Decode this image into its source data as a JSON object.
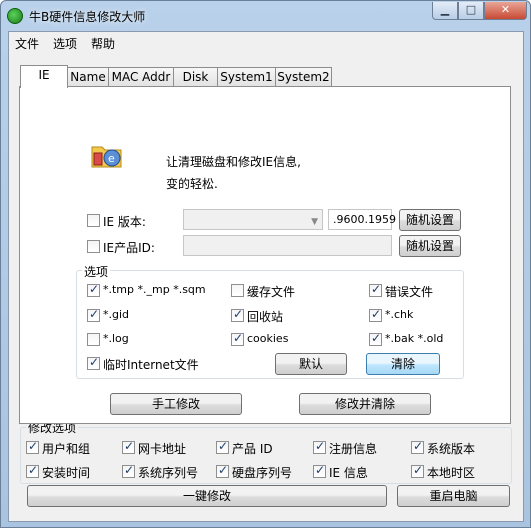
{
  "window": {
    "title": "牛B硬件信息修改大师"
  },
  "menu": [
    "文件",
    "选项",
    "帮助"
  ],
  "tabs": [
    "IE",
    "Name",
    "MAC Addr",
    "Disk",
    "System1",
    "System2"
  ],
  "ie_panel": {
    "desc_line1": "让清理磁盘和修改IE信息,",
    "desc_line2": "变的轻松.",
    "version_label": "IE 版本:",
    "version_value": "",
    "version_suffix": ".9600.1959",
    "product_label": "IE产品ID:",
    "product_value": "",
    "random_button": "随机设置",
    "options_title": "选项",
    "options": [
      {
        "label": "*.tmp  *._mp  *.sqm",
        "checked": true
      },
      {
        "label": "缓存文件",
        "checked": false
      },
      {
        "label": "错误文件",
        "checked": true
      },
      {
        "label": "*.gid",
        "checked": true
      },
      {
        "label": "回收站",
        "checked": true
      },
      {
        "label": "*.chk",
        "checked": true
      },
      {
        "label": "*.log",
        "checked": false
      },
      {
        "label": "cookies",
        "checked": true
      },
      {
        "label": "*.bak  *.old",
        "checked": true
      },
      {
        "label": "临时Internet文件",
        "checked": true
      }
    ],
    "default_button": "默认",
    "clear_button": "清除",
    "manual_button": "手工修改",
    "modify_clear_button": "修改并清除"
  },
  "modify_options": {
    "title": "修改选项",
    "items": [
      {
        "label": "用户和组",
        "checked": true
      },
      {
        "label": "网卡地址",
        "checked": true
      },
      {
        "label": "产品 ID",
        "checked": true
      },
      {
        "label": "注册信息",
        "checked": true
      },
      {
        "label": "系统版本",
        "checked": true
      },
      {
        "label": "安装时间",
        "checked": true
      },
      {
        "label": "系统序列号",
        "checked": true
      },
      {
        "label": "硬盘序列号",
        "checked": true
      },
      {
        "label": "IE 信息",
        "checked": true
      },
      {
        "label": "本地时区",
        "checked": true
      }
    ]
  },
  "bottom": {
    "one_click": "一键修改",
    "restart": "重启电脑"
  }
}
